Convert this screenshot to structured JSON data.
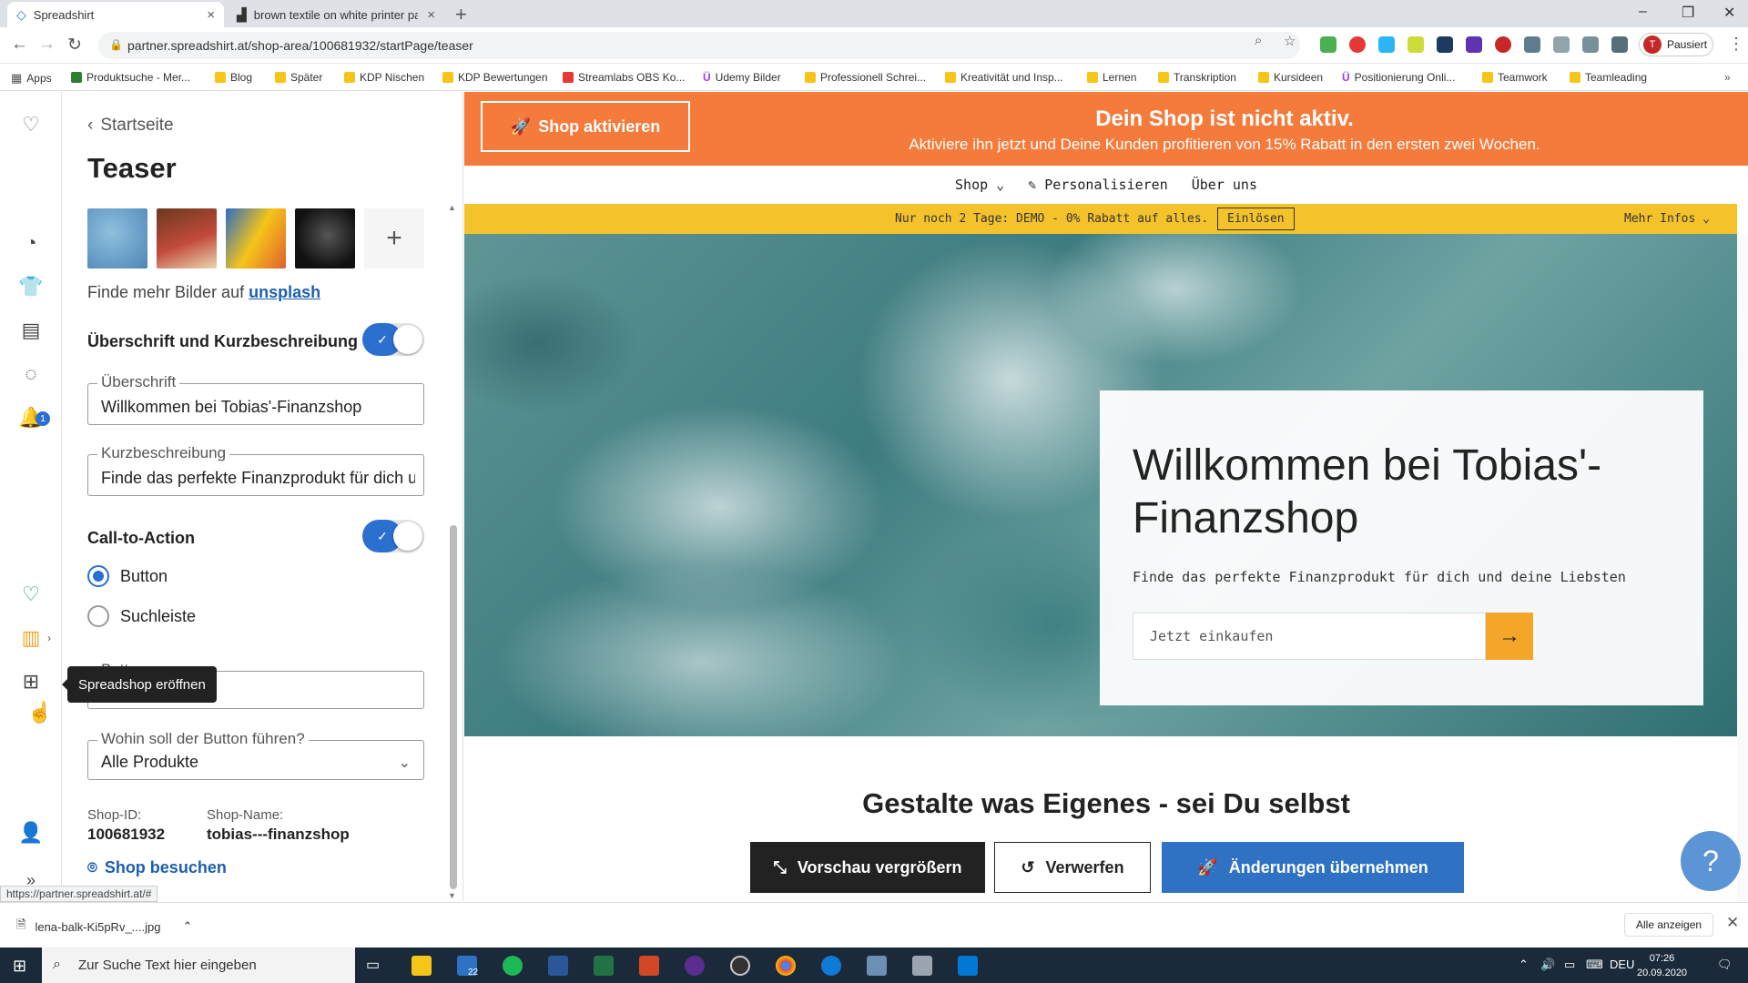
{
  "browser": {
    "tabs": [
      {
        "title": "Spreadshirt",
        "close": "×"
      },
      {
        "title": "brown textile on white printer pa",
        "close": "×"
      }
    ],
    "new_tab": "+",
    "url": "partner.spreadshirt.at/shop-area/100681932/startPage/teaser",
    "profile_initial": "T",
    "profile_label": "Pausiert",
    "bookmarks": [
      "Apps",
      "Produktsuche - Mer...",
      "Blog",
      "Später",
      "KDP Nischen",
      "KDP Bewertungen",
      "Streamlabs OBS Ko...",
      "Udemy Bilder",
      "Professionell Schrei...",
      "Kreativität und Insp...",
      "Lernen",
      "Transkription",
      "Kursideen",
      "Positionierung Onli...",
      "Teamwork",
      "Teamleading"
    ],
    "status_url": "https://partner.spreadshirt.at/#"
  },
  "rail": {
    "badge_count": "1",
    "tooltip": "Spreadshop eröffnen"
  },
  "panel": {
    "back_label": "Startseite",
    "title": "Teaser",
    "add_image": "+",
    "more_images_prefix": "Finde mehr Bilder auf ",
    "more_images_link": "unsplash",
    "section_heading": "Überschrift und Kurzbeschreibung",
    "headline_label": "Überschrift",
    "headline_value": "Willkommen bei Tobias'-Finanzshop",
    "desc_label": "Kurzbeschreibung",
    "desc_value": "Finde das perfekte Finanzprodukt für dich u",
    "cta_heading": "Call-to-Action",
    "radio_button": "Button",
    "radio_search": "Suchleiste",
    "button_field_label": "Button",
    "target_label": "Wohin soll der Button führen?",
    "target_value": "Alle Produkte",
    "shop_id_label": "Shop-ID:",
    "shop_id": "100681932",
    "shop_name_label": "Shop-Name:",
    "shop_name": "tobias---finanzshop",
    "visit_label": "Shop besuchen"
  },
  "preview": {
    "activate_label": "Shop aktivieren",
    "banner_title": "Dein Shop ist nicht aktiv.",
    "banner_sub": "Aktiviere ihn jetzt und Deine Kunden profitieren von 15% Rabatt in den ersten zwei Wochen.",
    "nav": [
      "Shop",
      "Personalisieren",
      "Über uns"
    ],
    "promo_text": "Nur noch 2 Tage: DEMO - 0% Rabatt auf alles.",
    "promo_redeem": "Einlösen",
    "promo_more": "Mehr Infos",
    "hero_title": "Willkommen bei Tobias'-Finanzshop",
    "hero_sub": "Finde das perfekte Finanzprodukt für dich und deine Liebsten",
    "search_placeholder": "Jetzt einkaufen",
    "section_title": "Gestalte was Eigenes - sei Du selbst",
    "btn_preview": "Vorschau vergrößern",
    "btn_discard": "Verwerfen",
    "btn_apply": "Änderungen übernehmen",
    "help": "?"
  },
  "downloads": {
    "file": "lena-balk-Ki5pRv_....jpg",
    "show_all": "Alle anzeigen"
  },
  "taskbar": {
    "search_placeholder": "Zur Suche Text hier eingeben",
    "mail_badge": "22",
    "lang": "DEU",
    "time": "07:26",
    "date": "20.09.2020"
  },
  "colors": {
    "banner": "#f47b3b",
    "promo": "#f4c22b",
    "accent_blue": "#2b6fcf",
    "search_button": "#f4a62a"
  }
}
